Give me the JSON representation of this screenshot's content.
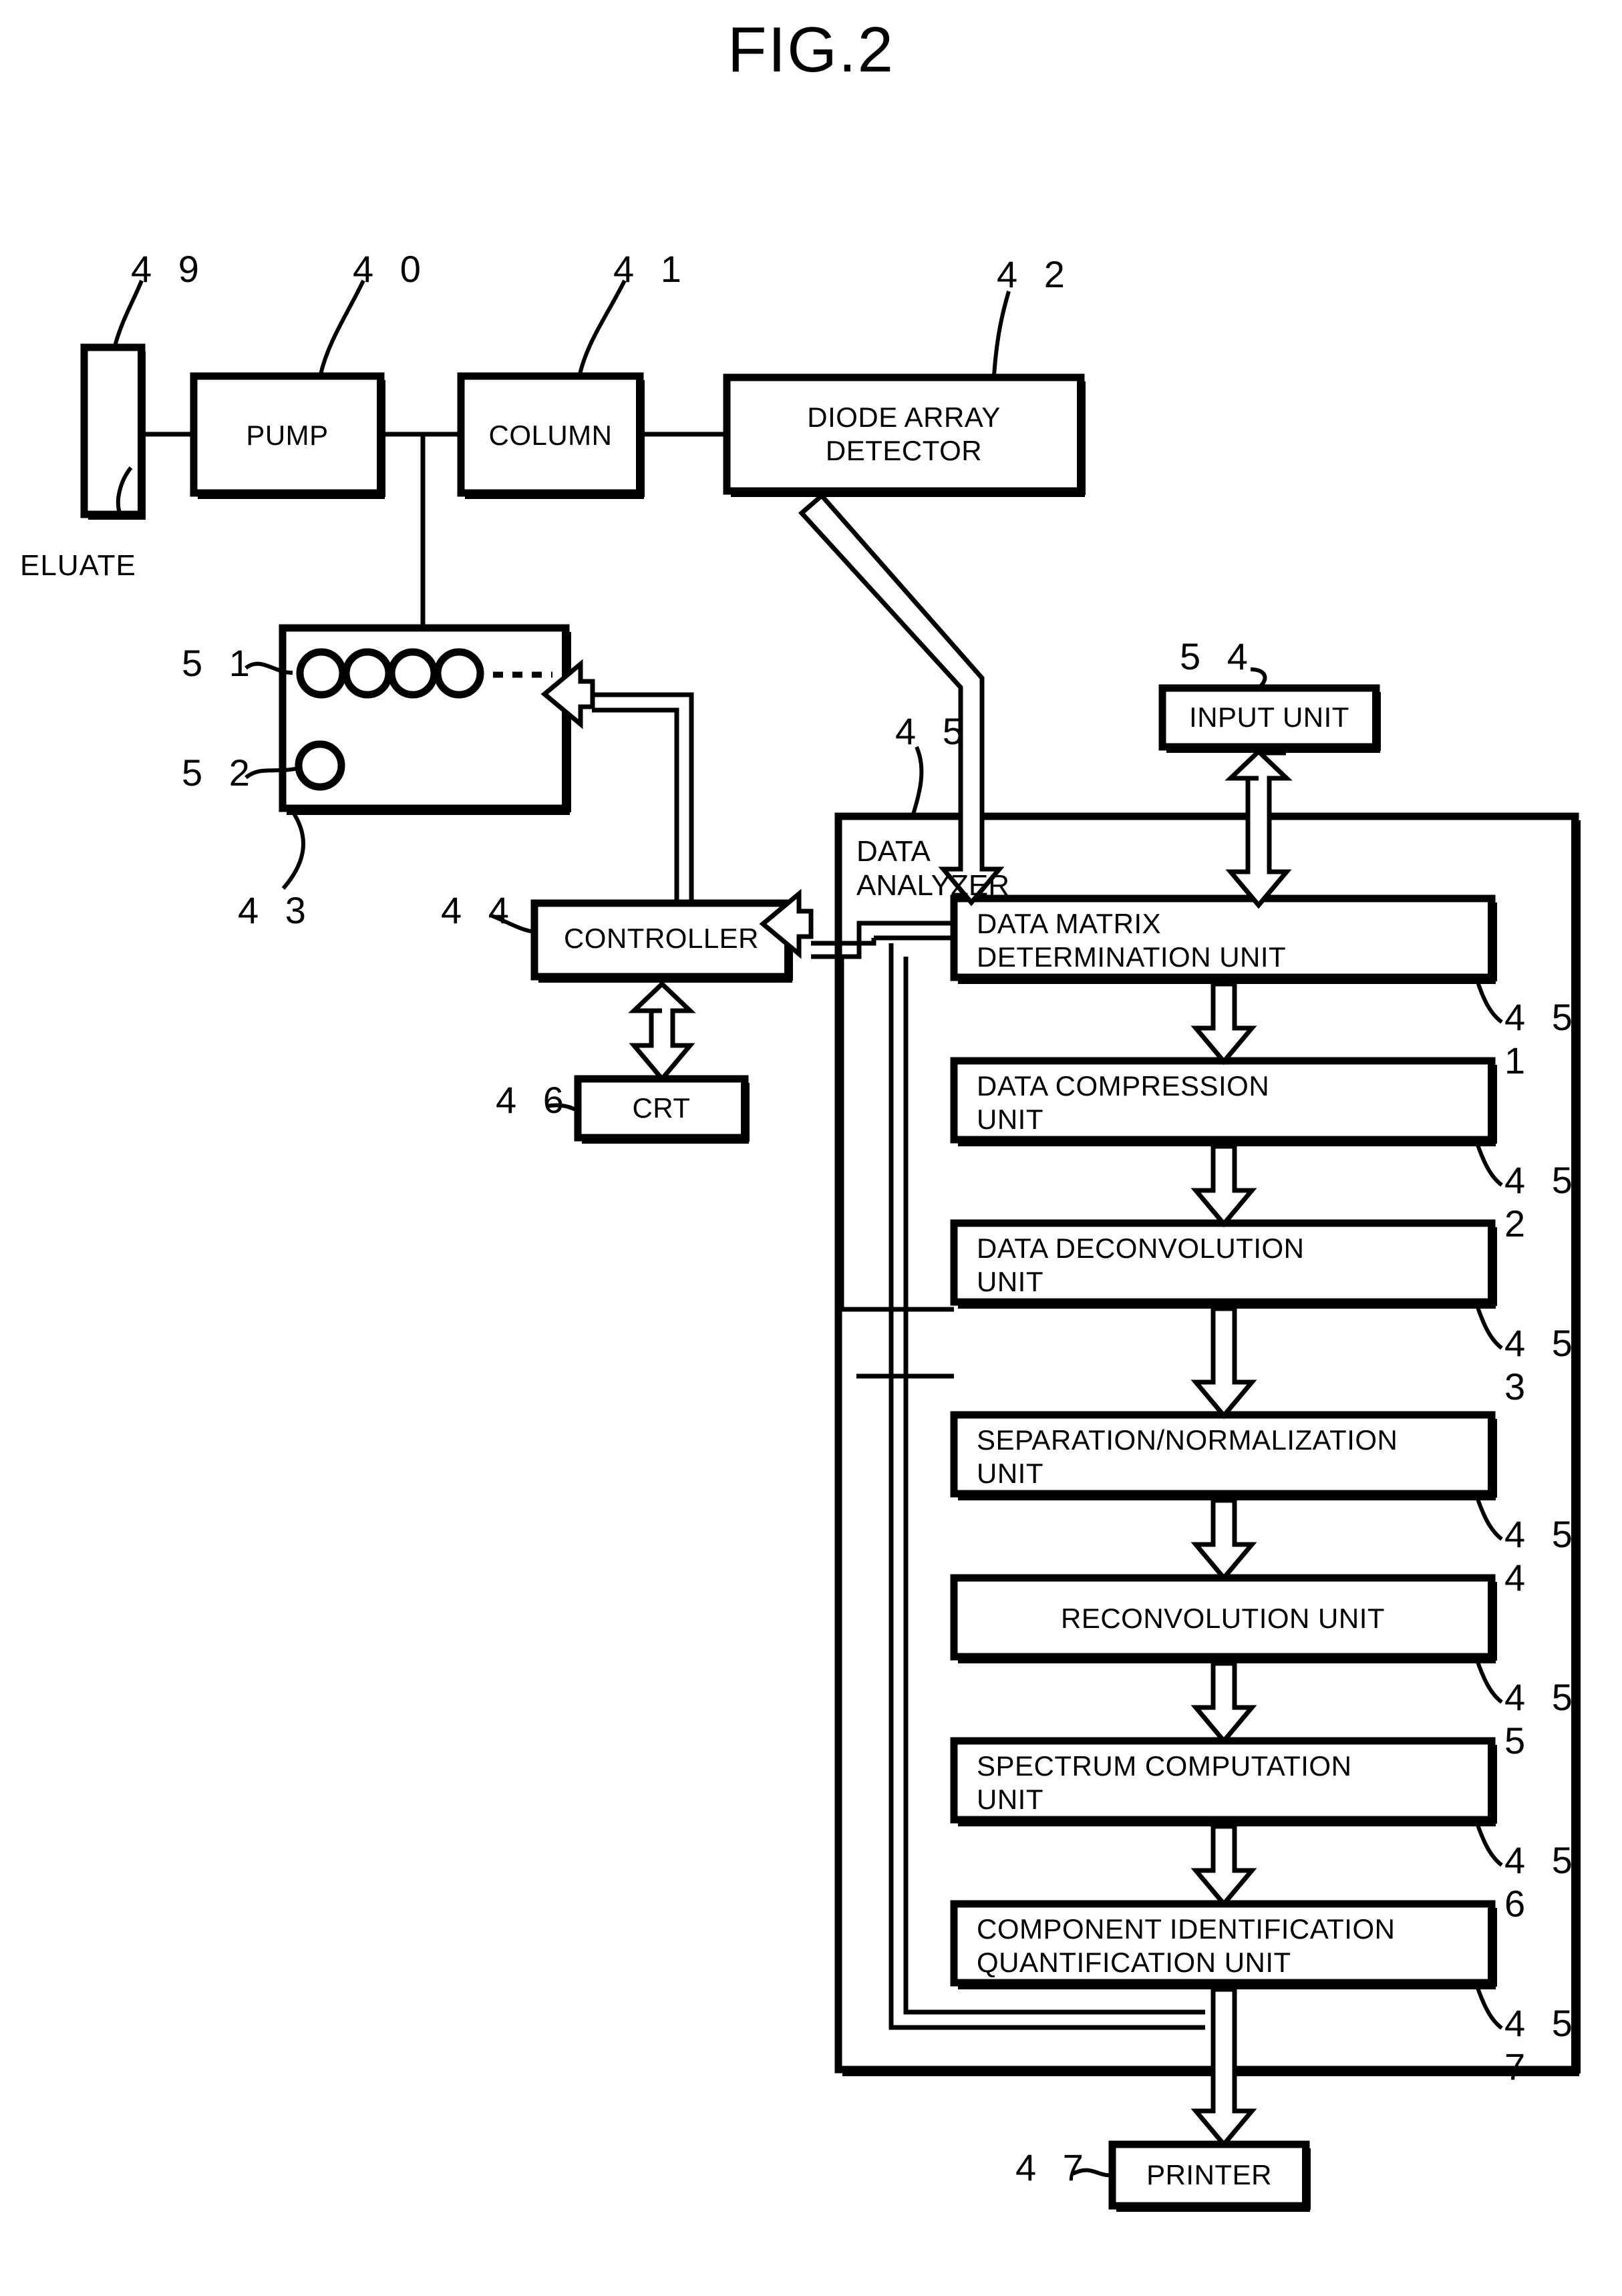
{
  "figure": {
    "title": "FIG.2",
    "caption_eluate": "ELUATE"
  },
  "blocks": {
    "eluate_vessel": {
      "label": "",
      "ref": "4 9"
    },
    "pump": {
      "label": "PUMP",
      "ref": "4 0"
    },
    "column": {
      "label": "COLUMN",
      "ref": "4 1"
    },
    "diode_array_detector": {
      "label": "DIODE ARRAY\nDETECTOR",
      "ref": "4 2"
    },
    "fraction_collector": {
      "label": "",
      "ref": "4 3",
      "vial_ref": "5 1",
      "waste_ref": "5 2",
      "vial_count": 4,
      "dash_count": 4
    },
    "controller": {
      "label": "CONTROLLER",
      "ref": "4 4"
    },
    "crt": {
      "label": "CRT",
      "ref": "4 6"
    },
    "input_unit": {
      "label": "INPUT UNIT",
      "ref": "5 4"
    },
    "printer": {
      "label": "PRINTER",
      "ref": "4 7"
    },
    "data_analyzer": {
      "label": "DATA\nANALYZER",
      "ref": "4 5"
    }
  },
  "analyzer_units": [
    {
      "label": "DATA MATRIX\nDETERMINATION UNIT",
      "ref": "4 5 1"
    },
    {
      "label": "DATA COMPRESSION\nUNIT",
      "ref": "4 5 2"
    },
    {
      "label": "DATA DECONVOLUTION\nUNIT",
      "ref": "4 5 3"
    },
    {
      "label": "SEPARATION/NORMALIZATION\nUNIT",
      "ref": "4 5 4"
    },
    {
      "label": "RECONVOLUTION UNIT",
      "ref": "4 5 5"
    },
    {
      "label": "SPECTRUM COMPUTATION\nUNIT",
      "ref": "4 5 6"
    },
    {
      "label": "COMPONENT IDENTIFICATION\nQUANTIFICATION UNIT",
      "ref": "4 5 7"
    }
  ],
  "colors": {
    "ink": "#000000",
    "paper": "#ffffff"
  }
}
